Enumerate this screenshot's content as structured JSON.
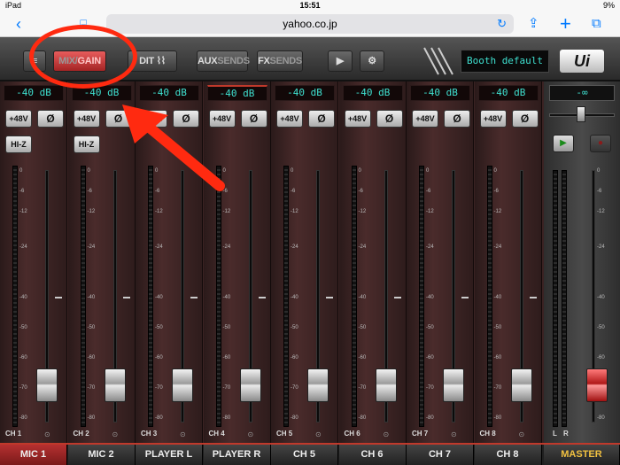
{
  "status": {
    "left": "iPad",
    "time": "15:51",
    "battery": "9%"
  },
  "safari": {
    "url": "yahoo.co.jp"
  },
  "toolbar": {
    "mix_gain_a": "MIX/",
    "mix_gain_b": "GAIN",
    "edit_label": "DIT",
    "aux_a": "AUX",
    "aux_b": "SENDS",
    "fx_a": "FX",
    "fx_b": "SENDS",
    "play": "▶",
    "gear": "⚙",
    "preset": "Booth default",
    "logo": "Ui"
  },
  "strip_buttons": {
    "phantom": "+48V",
    "phase": "Ø",
    "hiz": "HI-Z"
  },
  "meter_scale": [
    "0",
    "-6",
    "-12",
    "-24",
    "-40",
    "-50",
    "-60",
    "-70",
    "-80"
  ],
  "channels": [
    {
      "gain": "-40 dB",
      "ch": "CH 1",
      "name": "MIC 1",
      "hiz": true,
      "fader": 0.08
    },
    {
      "gain": "-40 dB",
      "ch": "CH 2",
      "name": "MIC 2",
      "hiz": true,
      "fader": 0.08
    },
    {
      "gain": "-40 dB",
      "ch": "CH 3",
      "name": "PLAYER L",
      "hiz": false,
      "fader": 0.08
    },
    {
      "gain": "-40 dB",
      "ch": "CH 4",
      "name": "PLAYER R",
      "hiz": false,
      "fader": 0.08
    },
    {
      "gain": "-40 dB",
      "ch": "CH 5",
      "name": "CH 5",
      "hiz": false,
      "fader": 0.08
    },
    {
      "gain": "-40 dB",
      "ch": "CH 6",
      "name": "CH 6",
      "hiz": false,
      "fader": 0.08
    },
    {
      "gain": "-40 dB",
      "ch": "CH 7",
      "name": "CH 7",
      "hiz": false,
      "fader": 0.08
    },
    {
      "gain": "-40 dB",
      "ch": "CH 8",
      "name": "CH 8",
      "hiz": false,
      "fader": 0.08
    }
  ],
  "master": {
    "gain": "-∞",
    "name": "MASTER",
    "l": "L",
    "r": "R",
    "fader": 0.08,
    "scale": [
      "0",
      "-6",
      "-12",
      "-24",
      "-40",
      "-50",
      "-60",
      "-70",
      "-80"
    ]
  },
  "colors": {
    "accent": "#c0392b",
    "display": "#3fe0d0",
    "master_label": "#f0c040"
  }
}
